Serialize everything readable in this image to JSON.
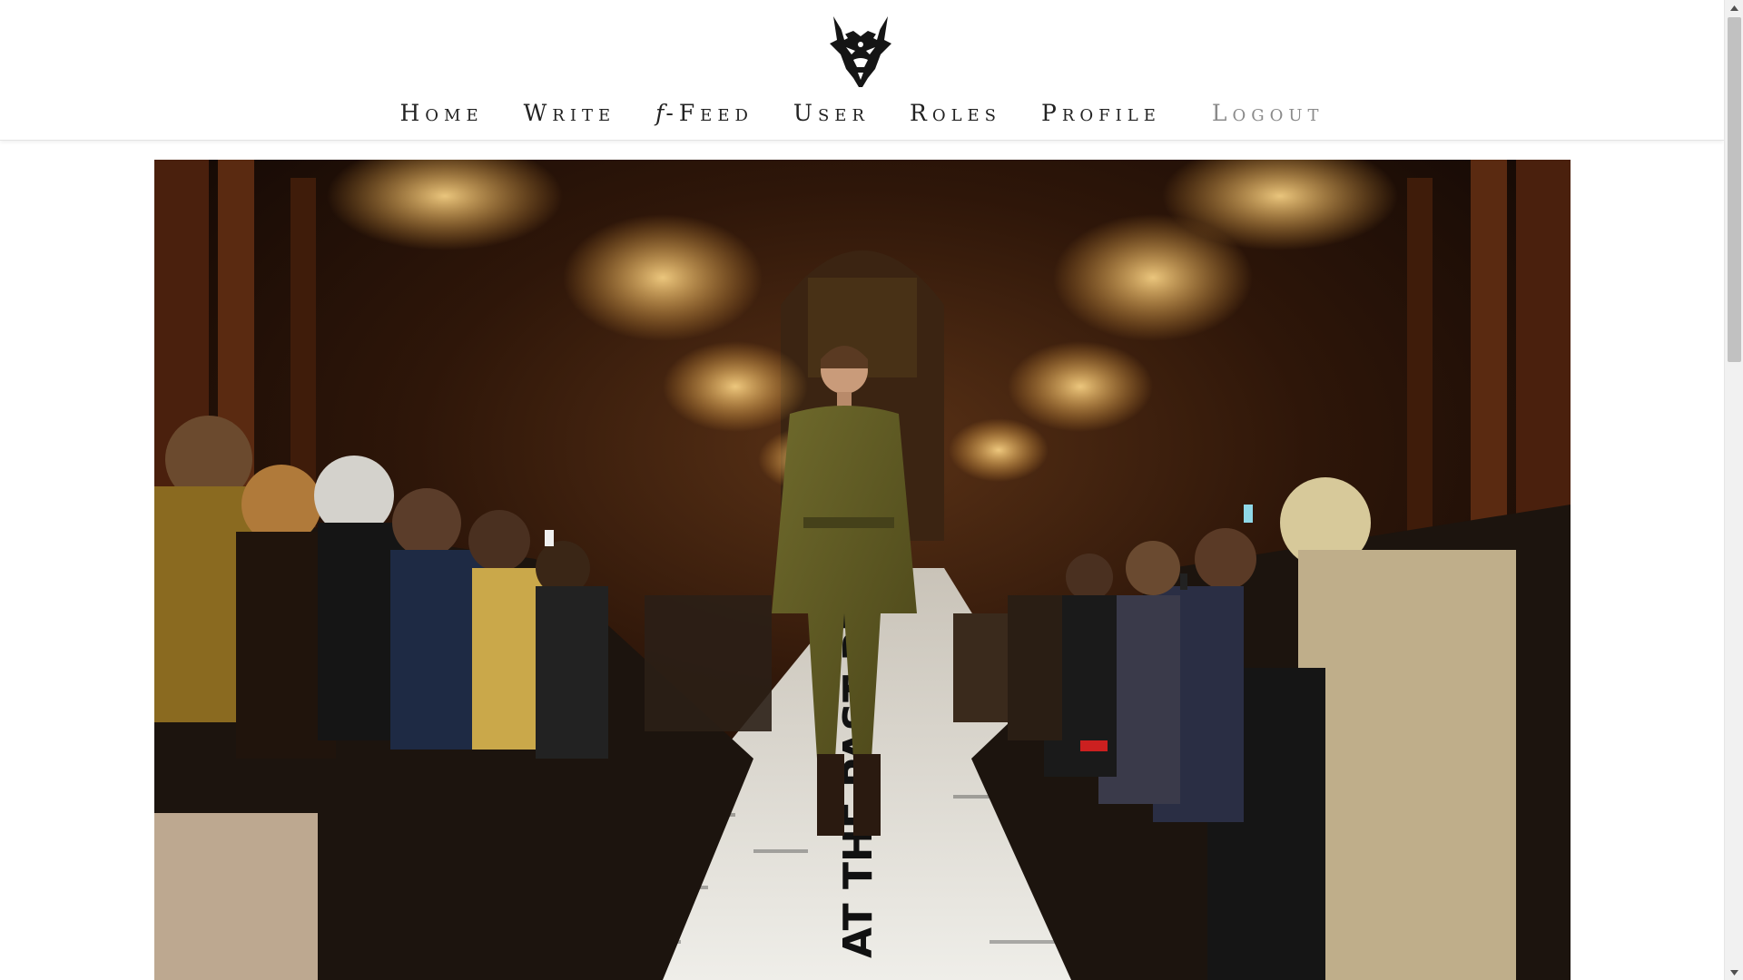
{
  "header": {
    "logo_icon": "wolf-head-logo-icon",
    "nav": [
      {
        "id": "home",
        "label": "Home"
      },
      {
        "id": "write",
        "label": "Write"
      },
      {
        "id": "ffeed",
        "prefix": "f",
        "label": "-Feed"
      },
      {
        "id": "user",
        "label": "User"
      },
      {
        "id": "roles",
        "label": "Roles"
      },
      {
        "id": "profile",
        "label": "Profile"
      },
      {
        "id": "logout",
        "label": "Logout"
      }
    ]
  },
  "hero": {
    "image_icon": "fashion-runway-photo",
    "runway_text": "AT THE PAST PREC"
  },
  "scrollbar": {
    "up_icon": "scroll-up-arrow-icon",
    "down_icon": "scroll-down-arrow-icon"
  },
  "colors": {
    "nav_text": "#222222",
    "logout_text": "#8a8a8a",
    "header_bg": "#ffffff"
  }
}
